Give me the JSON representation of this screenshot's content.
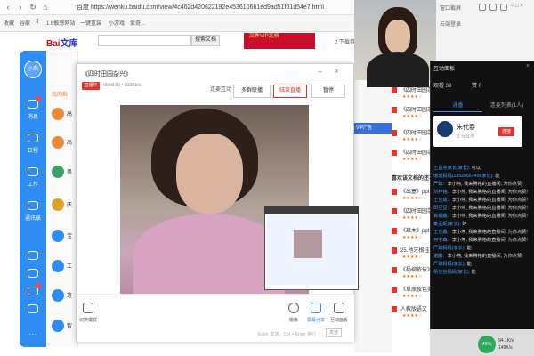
{
  "browser": {
    "address": "百度  https://wenku.baidu.com/view/4c462d420622192e453610661ed9ad51f01d54e7.html",
    "bookmarks": [
      "收藏",
      "谷歌",
      "t(",
      "1 b敏感网站",
      "一键重装",
      "小游戏",
      "爱奇… "
    ],
    "login_hint": "安全浏览"
  },
  "baidu": {
    "logo_left": "Bai",
    "logo_right": "文库",
    "search_button": "搜索文档",
    "ad_banner": "文件VIP文档",
    "download_text": "2 下载券"
  },
  "nav": {
    "avatar": "小燕",
    "items": [
      "消息",
      "日程",
      "工作",
      "通讯录"
    ],
    "bottom_avatar": "小燕"
  },
  "list": {
    "header": "我的群",
    "items": [
      {
        "title": "高",
        "sub": "群聊",
        "color": "#e9893b"
      },
      {
        "title": "高",
        "sub": "群聊",
        "color": "#e9893b"
      },
      {
        "title": "奥",
        "sub": "好友",
        "color": "#3da06b"
      },
      {
        "title": "庆",
        "sub": "群聊",
        "color": "#e0a12a"
      },
      {
        "title": "宝",
        "sub": "家长",
        "color": "#2f8cf2"
      },
      {
        "title": "工",
        "sub": "工作",
        "color": "#2f8cf2"
      },
      {
        "title": "班",
        "sub": "班级",
        "color": "#2f8cf2"
      },
      {
        "title": "智",
        "sub": "通知",
        "color": "#2f8cf2"
      }
    ]
  },
  "dialog": {
    "title": "《四时田园杂兴》",
    "live_badge": "直播中",
    "stats": "00:03:01  • 813Kb/s",
    "buttons": [
      "连麦互动",
      "多群联播",
      "结束直播",
      "暂停"
    ],
    "bottom": {
      "layout": "切换模式",
      "camera": "摄像",
      "share": "屏幕分享",
      "interact": "互动面板"
    },
    "input_hint": "Enter 发送，Ctrl + Enter 换行",
    "send": "发送"
  },
  "docs": {
    "items": [
      "《四时田园杂兴》",
      "《四时田园杂兴》",
      "《四时田园杂兴》",
      "《四时田园杂兴》"
    ],
    "section_title": "喜欢该文档的还喜欢",
    "more": [
      "《出塞》ppt",
      "《四时田园杂兴》",
      "《草木》ppt",
      "25.他牙根挂",
      "《杨柳依依》",
      "《草原夜色美》",
      "人教版语文"
    ]
  },
  "right_top": {
    "label1": "窗口截屏",
    "label2": "云端登录"
  },
  "panel": {
    "title": "互动面板",
    "viewers": "观看 39",
    "likes": "赞 0",
    "tabs": [
      "涌香",
      "连麦列表(1人)"
    ],
    "host_name": "朱代春",
    "host_sub": "正在直播",
    "follow": "连接",
    "chat": [
      {
        "name": "王邕尧家长(家长):",
        "text": " 可以"
      },
      {
        "name": "瑶瑶妈妈(13520667456家长):",
        "text": " 能"
      },
      {
        "name": "严臻：",
        "text": "李小燕, 我来腾格的直播间, 为你点赞!"
      },
      {
        "name": "刘梓铭：",
        "text": "李小燕, 我来腾格的直播间, 为你点赞!"
      },
      {
        "name": "王佳成：",
        "text": "李小燕, 我来腾格的直播间, 为你点赞!"
      },
      {
        "name": "阳豆豆：",
        "text": "李小燕, 我来腾格的直播间, 为你点赞!"
      },
      {
        "name": "肖铜鑫：",
        "text": "李小燕, 我来腾格的直播间, 为你点赞!"
      },
      {
        "name": "秦孟妮(家长):",
        "text": " 好"
      },
      {
        "name": "王佳鑫：",
        "text": "李小燕, 我来腾格的直播间, 为你点赞!"
      },
      {
        "name": "何宇森：",
        "text": "李小燕, 我来腾格的直播间, 为你点赞!"
      },
      {
        "name": "严臻妈妈(家长):",
        "text": " 能"
      },
      {
        "name": "谢鹏：",
        "text": "李小燕, 我来腾格的直播间, 为你点赞!"
      },
      {
        "name": "严臻妈妈(家长):",
        "text": " 能"
      },
      {
        "name": "杨佳怡妈妈(家长):",
        "text": " 能"
      }
    ]
  },
  "taskbar": {
    "percent": "49%",
    "up": "94.1K/s",
    "down": "149K/s"
  }
}
